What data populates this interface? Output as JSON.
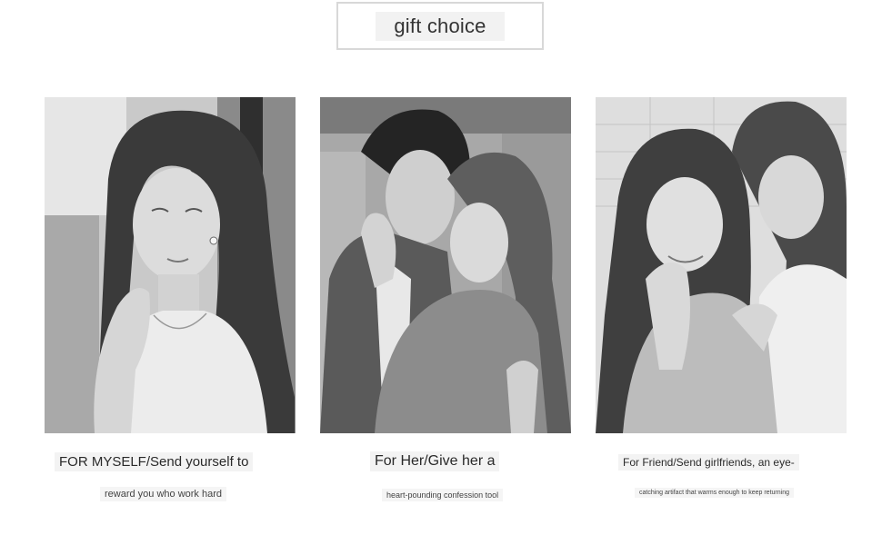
{
  "header": {
    "title": "gift choice"
  },
  "cards": [
    {
      "photo": "portrait-woman-earrings-photo",
      "caption": "FOR MYSELF/Send yourself to",
      "subcaption": "reward you who work hard"
    },
    {
      "photo": "couple-embracing-photo",
      "caption": "For Her/Give her a",
      "subcaption": "heart-pounding confession tool"
    },
    {
      "photo": "two-friends-smiling-photo",
      "caption": "For Friend/Send girlfriends, an eye-",
      "subcaption": "catching artifact that warms enough to keep returning"
    }
  ],
  "colors": {
    "background": "#ffffff",
    "frame_border": "#d8d8d8",
    "caption_bg": "#f3f3f3",
    "photo_tone": "grayscale"
  }
}
